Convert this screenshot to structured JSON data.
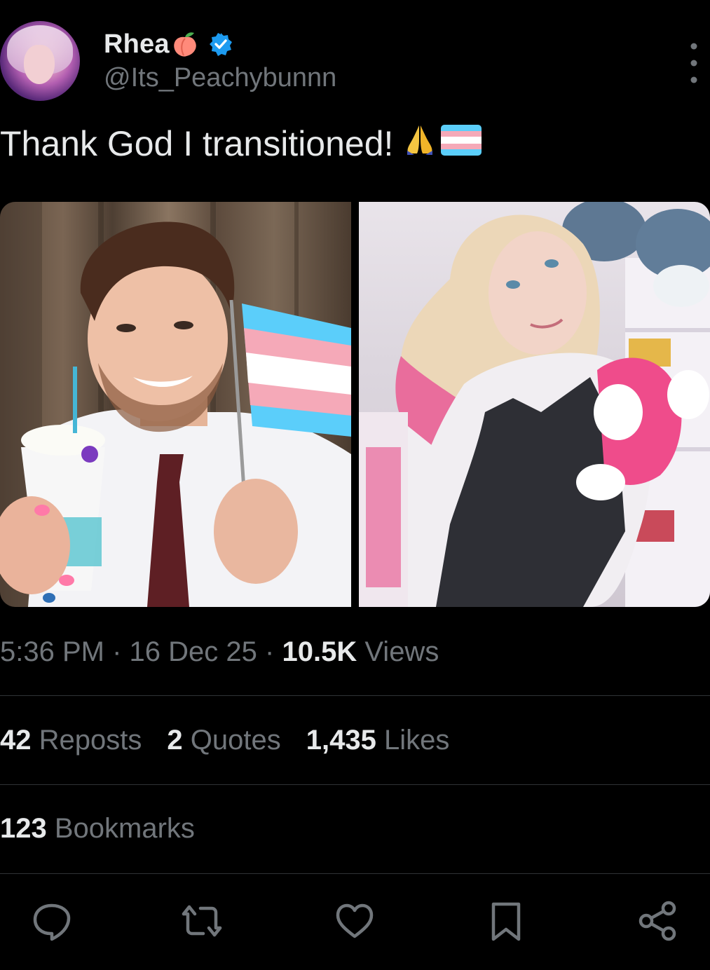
{
  "tweet": {
    "author": {
      "display_name": "Rhea",
      "name_emoji": "peach-icon",
      "verified": true,
      "handle": "@Its_Peachybunnn"
    },
    "text": "Thank God I transitioned!",
    "text_emojis": [
      "folded-hands-icon",
      "transgender-flag-icon"
    ],
    "media": [
      {
        "kind": "photo"
      },
      {
        "kind": "photo"
      }
    ],
    "time": "5:36 PM",
    "date": "16 Dec 25",
    "separator": "·",
    "views_count": "10.5K",
    "views_label": "Views",
    "reposts_count": "42",
    "reposts_label": "Reposts",
    "quotes_count": "2",
    "quotes_label": "Quotes",
    "likes_count": "1,435",
    "likes_label": "Likes",
    "bookmarks_count": "123",
    "bookmarks_label": "Bookmarks"
  },
  "actions": [
    "reply-icon",
    "repost-icon",
    "like-icon",
    "bookmark-icon",
    "share-icon"
  ],
  "colors": {
    "background": "#000000",
    "primary_text": "#e7e9ea",
    "secondary_text": "#71767b",
    "divider": "#2f3336",
    "verified": "#1d9bf0"
  }
}
